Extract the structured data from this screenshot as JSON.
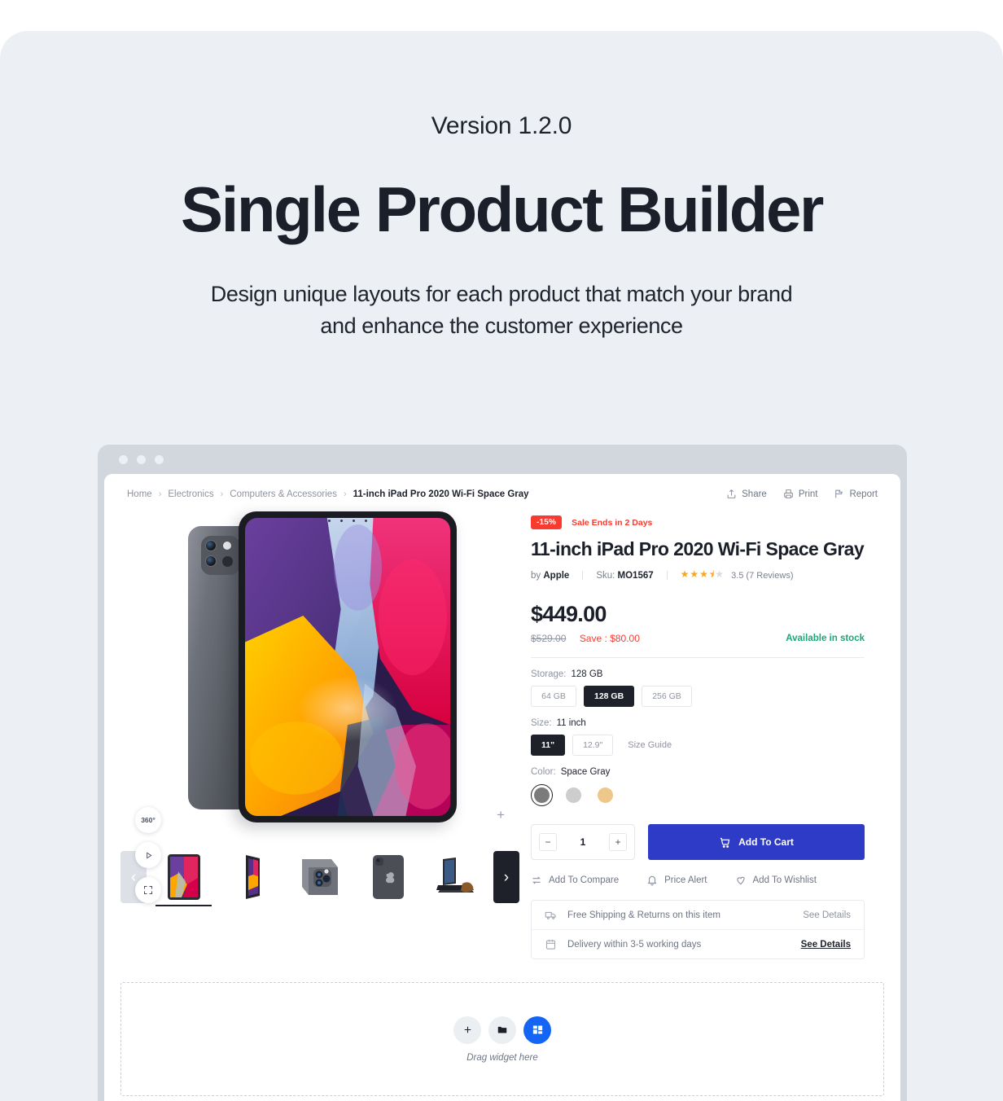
{
  "hero": {
    "version": "Version 1.2.0",
    "title": "Single Product Builder",
    "subtitle_line1": "Design unique layouts for each product that match your brand",
    "subtitle_line2": "and enhance the customer experience"
  },
  "browser": {
    "dots": [
      "dot-1",
      "dot-2",
      "dot-3"
    ]
  },
  "breadcrumb": {
    "items": [
      {
        "label": "Home",
        "active": false
      },
      {
        "label": "Electronics",
        "active": false
      },
      {
        "label": "Computers & Accessories",
        "active": false
      },
      {
        "label": "11-inch iPad Pro 2020 Wi-Fi Space Gray",
        "active": true
      }
    ],
    "separator": "›"
  },
  "toolbar": {
    "share_label": "Share",
    "print_label": "Print",
    "report_label": "Report"
  },
  "gallery": {
    "controls": {
      "three_sixty": "360°",
      "play": "play-icon",
      "fullscreen": "fullscreen-icon"
    },
    "expand_icon": "+",
    "prev_arrow": "‹",
    "next_arrow": "›",
    "thumbnails": [
      {
        "name": "ipad-front-wallpaper",
        "selected": true
      },
      {
        "name": "ipad-angled-front",
        "selected": false
      },
      {
        "name": "ipad-camera-closeup",
        "selected": false
      },
      {
        "name": "ipad-back-space-gray",
        "selected": false
      },
      {
        "name": "ipad-magic-keyboard",
        "selected": false
      }
    ]
  },
  "product": {
    "discount_badge": "-15%",
    "sale_ends": "Sale Ends in 2 Days",
    "title": "11-inch iPad Pro 2020 Wi-Fi Space Gray",
    "brand_prefix": "by",
    "brand": "Apple",
    "sku_label": "Sku:",
    "sku": "MO1567",
    "rating_value": 3.5,
    "rating_text": "3.5 (7 Reviews)",
    "price": "$449.00",
    "price_old": "$529.00",
    "price_save": "Save : $80.00",
    "stock": "Available in stock",
    "options": {
      "storage": {
        "label": "Storage:",
        "value": "128 GB",
        "choices": [
          {
            "label": "64 GB",
            "selected": false
          },
          {
            "label": "128 GB",
            "selected": true
          },
          {
            "label": "256 GB",
            "selected": false
          }
        ]
      },
      "size": {
        "label": "Size:",
        "value": "11 inch",
        "choices": [
          {
            "label": "11\"",
            "selected": true
          },
          {
            "label": "12.9\"",
            "selected": false
          }
        ],
        "guide_label": "Size Guide"
      },
      "color": {
        "label": "Color:",
        "value": "Space Gray",
        "choices": [
          {
            "name": "space-gray",
            "hex": "#7b7b7b",
            "selected": true
          },
          {
            "name": "silver",
            "hex": "#cdcdcd",
            "selected": false
          },
          {
            "name": "gold",
            "hex": "#edc88a",
            "selected": false
          }
        ]
      }
    },
    "quantity": {
      "value": "1",
      "minus": "−",
      "plus": "+"
    },
    "add_to_cart": "Add To Cart",
    "secondary_links": [
      {
        "label": "Add To Compare",
        "icon": "compare-icon"
      },
      {
        "label": "Price Alert",
        "icon": "bell-icon"
      },
      {
        "label": "Add To Wishlist",
        "icon": "heart-icon"
      }
    ],
    "shipping": [
      {
        "icon": "truck-icon",
        "text": "Free Shipping & Returns on this item",
        "action": "See Details",
        "strong": false
      },
      {
        "icon": "calendar-icon",
        "text": "Delivery within 3-5 working days",
        "action": "See Details",
        "strong": true
      }
    ]
  },
  "dropzone": {
    "buttons": [
      {
        "name": "add-widget-button",
        "glyph": "+",
        "accent": false
      },
      {
        "name": "folder-button",
        "glyph": "folder-icon",
        "accent": false
      },
      {
        "name": "widgets-button",
        "glyph": "widgets-icon",
        "accent": true
      }
    ],
    "hint": "Drag widget here"
  },
  "colors": {
    "page_bg": "#eceff4",
    "accent_blue": "#2e3bc6",
    "widget_blue": "#1565f5",
    "sale_red": "#f93b2f",
    "stock_green": "#1aa87a",
    "dark": "#1e2129"
  }
}
